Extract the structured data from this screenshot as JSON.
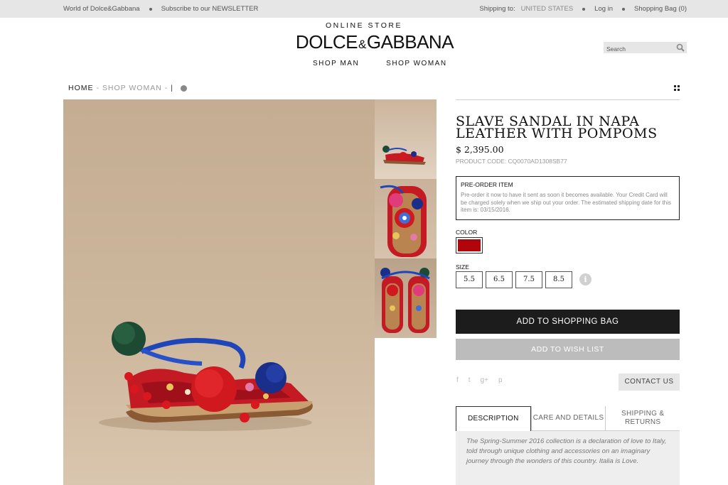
{
  "topbar": {
    "world": "World of Dolce&Gabbana",
    "newsletter": "Subscribe to our NEWSLETTER",
    "shipping_label": "Shipping to:",
    "shipping_country": "UNITED STATES",
    "login": "Log in",
    "bag": "Shopping Bag (0)"
  },
  "header": {
    "store_label": "ONLINE STORE",
    "logo_left": "DOLCE",
    "logo_amp": "&",
    "logo_right": "GABBANA",
    "nav": [
      "SHOP MAN",
      "SHOP WOMAN"
    ],
    "search_placeholder": "Search"
  },
  "breadcrumb": {
    "home": "HOME",
    "section": "- SHOP WOMAN -",
    "sep": "|"
  },
  "product": {
    "title": "SLAVE SANDAL IN NAPA LEATHER WITH POMPOMS",
    "price": "$ 2,395.00",
    "code": "PRODUCT CODE: CQ0070AD1308SB77",
    "preorder_heading": "PRE-ORDER ITEM",
    "preorder_text": "Pre-order it now to have it sent as soon it becomes available. Your Credit Card will be charged solely when we ship out your order. The estimated shipping date for this item is: 03/15/2016.",
    "color_label": "COLOR",
    "color_swatch": "#b0060b",
    "size_label": "SIZE",
    "sizes": [
      "5.5",
      "6.5",
      "7.5",
      "8.5"
    ],
    "info_glyph": "i",
    "add_to_bag": "ADD TO SHOPPING BAG",
    "add_to_wishlist": "ADD TO WISH LIST",
    "social": [
      "f",
      "t",
      "g+",
      "p"
    ],
    "contact": "CONTACT US"
  },
  "tabs": {
    "items": [
      "DESCRIPTION",
      "CARE AND DETAILS",
      "SHIPPING & RETURNS"
    ],
    "description": "The Spring-Summer 2016 collection is a declaration of love to Italy, told through unique clothing and accessories on an imaginary journey through the wonders of this country. Italia is Love."
  },
  "colors": {
    "topbar_bg": "#e6e6e6",
    "bag_button": "#1c1c1c",
    "wish_button": "#bcbcbc",
    "image_bg": "#c9b39a"
  }
}
